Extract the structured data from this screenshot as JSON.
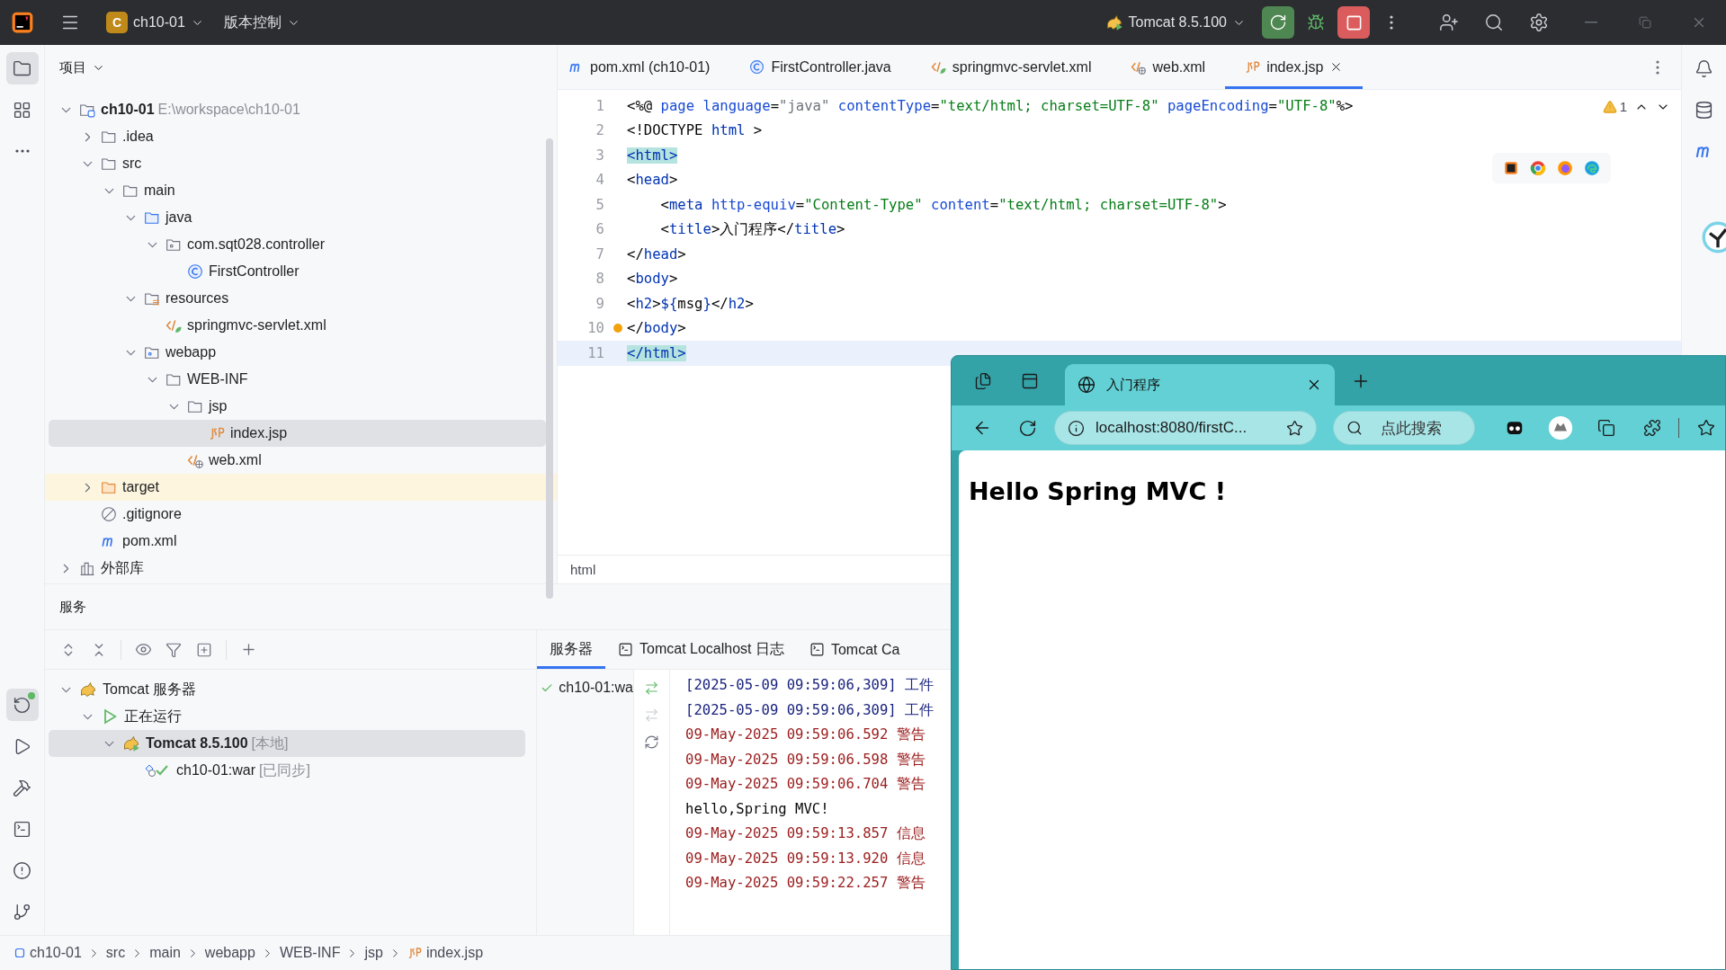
{
  "title_bar": {
    "project_badge": "C",
    "project": "ch10-01",
    "vcs": "版本控制",
    "run_config": "Tomcat 8.5.100"
  },
  "left_tools": [
    {
      "kind": "project",
      "selected": true
    },
    {
      "kind": "structure",
      "selected": false
    },
    {
      "kind": "more",
      "selected": false
    }
  ],
  "left_tools_bottom": [
    {
      "kind": "services",
      "selected": true
    },
    {
      "kind": "run",
      "selected": false
    },
    {
      "kind": "build",
      "selected": false
    },
    {
      "kind": "terminal",
      "selected": false
    },
    {
      "kind": "problems",
      "selected": false
    },
    {
      "kind": "git",
      "selected": false
    }
  ],
  "project_panel": {
    "title": "项目",
    "tree": [
      {
        "label": "ch10-01",
        "path": "E:\\workspace\\ch10-01",
        "kind": "module",
        "expanded": true,
        "selected": false,
        "children": [
          {
            "label": ".idea",
            "kind": "folder",
            "expanded": false,
            "selected": false
          },
          {
            "label": "src",
            "kind": "folder",
            "expanded": true,
            "selected": false,
            "children": [
              {
                "label": "main",
                "kind": "folder",
                "expanded": true,
                "selected": false,
                "children": [
                  {
                    "label": "java",
                    "kind": "source",
                    "expanded": true,
                    "selected": false,
                    "children": [
                      {
                        "label": "com.sqt028.controller",
                        "kind": "package",
                        "expanded": true,
                        "selected": false,
                        "children": [
                          {
                            "label": "FirstController",
                            "kind": "class",
                            "selected": false
                          }
                        ]
                      }
                    ]
                  },
                  {
                    "label": "resources",
                    "kind": "resources",
                    "expanded": true,
                    "selected": false,
                    "children": [
                      {
                        "label": "springmvc-servlet.xml",
                        "kind": "spring-xml",
                        "selected": false
                      }
                    ]
                  },
                  {
                    "label": "webapp",
                    "kind": "webapp",
                    "expanded": true,
                    "selected": false,
                    "children": [
                      {
                        "label": "WEB-INF",
                        "kind": "folder",
                        "expanded": true,
                        "selected": false,
                        "children": [
                          {
                            "label": "jsp",
                            "kind": "folder",
                            "expanded": true,
                            "selected": false,
                            "children": [
                              {
                                "label": "index.jsp",
                                "kind": "jsp",
                                "selected": true
                              }
                            ]
                          },
                          {
                            "label": "web.xml",
                            "kind": "web-xml",
                            "selected": false
                          }
                        ]
                      }
                    ]
                  }
                ]
              }
            ]
          },
          {
            "label": "target",
            "kind": "excluded",
            "expanded": false,
            "selected": false
          },
          {
            "label": ".gitignore",
            "kind": "ignored",
            "selected": false
          },
          {
            "label": "pom.xml",
            "kind": "maven",
            "selected": false
          }
        ]
      },
      {
        "label": "外部库",
        "kind": "library",
        "expanded": false,
        "selected": false
      }
    ]
  },
  "editor": {
    "tabs": [
      {
        "label": "pom.xml (ch10-01)",
        "kind": "maven",
        "selected": false
      },
      {
        "label": "FirstController.java",
        "kind": "class",
        "selected": false
      },
      {
        "label": "springmvc-servlet.xml",
        "kind": "spring-xml",
        "selected": false
      },
      {
        "label": "web.xml",
        "kind": "web-xml",
        "selected": false
      },
      {
        "label": "index.jsp",
        "kind": "jsp",
        "selected": true
      }
    ],
    "warnings": "1",
    "lines": [
      {
        "number": "1",
        "current": false,
        "intention": false,
        "tokens": [
          {
            "text": "<%@ ",
            "kind": "plain"
          },
          {
            "text": "page language",
            "kind": "attr"
          },
          {
            "text": "=",
            "kind": "plain"
          },
          {
            "text": "\"java\"",
            "kind": "muted"
          },
          {
            "text": " contentType",
            "kind": "attr"
          },
          {
            "text": "=",
            "kind": "plain"
          },
          {
            "text": "\"text/html; charset=UTF-8\"",
            "kind": "str"
          },
          {
            "text": " pageEncoding",
            "kind": "attr"
          },
          {
            "text": "=",
            "kind": "plain"
          },
          {
            "text": "\"UTF-8\"",
            "kind": "str"
          },
          {
            "text": "%>",
            "kind": "plain"
          }
        ]
      },
      {
        "number": "2",
        "current": false,
        "intention": false,
        "tokens": [
          {
            "text": "<!DOCTYPE ",
            "kind": "plain"
          },
          {
            "text": "html",
            "kind": "tag"
          },
          {
            "text": " >",
            "kind": "plain"
          }
        ]
      },
      {
        "number": "3",
        "current": false,
        "intention": false,
        "tokens": [
          {
            "text": "<html>",
            "kind": "match"
          }
        ]
      },
      {
        "number": "4",
        "current": false,
        "intention": false,
        "tokens": [
          {
            "text": "<",
            "kind": "plain"
          },
          {
            "text": "head",
            "kind": "tag"
          },
          {
            "text": ">",
            "kind": "plain"
          }
        ]
      },
      {
        "number": "5",
        "current": false,
        "intention": false,
        "tokens": [
          {
            "text": "    <",
            "kind": "plain"
          },
          {
            "text": "meta",
            "kind": "tag"
          },
          {
            "text": " http-equiv",
            "kind": "attr"
          },
          {
            "text": "=",
            "kind": "plain"
          },
          {
            "text": "\"Content-Type\"",
            "kind": "str"
          },
          {
            "text": " content",
            "kind": "attr"
          },
          {
            "text": "=",
            "kind": "plain"
          },
          {
            "text": "\"text/html; charset=UTF-8\"",
            "kind": "str"
          },
          {
            "text": ">",
            "kind": "plain"
          }
        ]
      },
      {
        "number": "6",
        "current": false,
        "intention": false,
        "tokens": [
          {
            "text": "    <",
            "kind": "plain"
          },
          {
            "text": "title",
            "kind": "tag"
          },
          {
            "text": ">入门程序</",
            "kind": "plain"
          },
          {
            "text": "title",
            "kind": "tag"
          },
          {
            "text": ">",
            "kind": "plain"
          }
        ]
      },
      {
        "number": "7",
        "current": false,
        "intention": false,
        "tokens": [
          {
            "text": "</",
            "kind": "plain"
          },
          {
            "text": "head",
            "kind": "tag"
          },
          {
            "text": ">",
            "kind": "plain"
          }
        ]
      },
      {
        "number": "8",
        "current": false,
        "intention": false,
        "tokens": [
          {
            "text": "<",
            "kind": "plain"
          },
          {
            "text": "body",
            "kind": "tag"
          },
          {
            "text": ">",
            "kind": "plain"
          }
        ]
      },
      {
        "number": "9",
        "current": false,
        "intention": false,
        "tokens": [
          {
            "text": "<",
            "kind": "plain"
          },
          {
            "text": "h2",
            "kind": "tag"
          },
          {
            "text": ">",
            "kind": "plain"
          },
          {
            "text": "${",
            "kind": "tag"
          },
          {
            "text": "msg",
            "kind": "plain"
          },
          {
            "text": "}",
            "kind": "tag"
          },
          {
            "text": "</",
            "kind": "plain"
          },
          {
            "text": "h2",
            "kind": "tag"
          },
          {
            "text": ">",
            "kind": "plain"
          }
        ]
      },
      {
        "number": "10",
        "current": false,
        "intention": true,
        "tokens": [
          {
            "text": "</",
            "kind": "plain"
          },
          {
            "text": "body",
            "kind": "tag"
          },
          {
            "text": ">",
            "kind": "plain"
          }
        ]
      },
      {
        "number": "11",
        "current": true,
        "intention": false,
        "tokens": [
          {
            "text": "</html>",
            "kind": "match"
          }
        ]
      }
    ],
    "breadcrumb": "html"
  },
  "services": {
    "title": "服务",
    "tree": [
      {
        "label": "Tomcat 服务器",
        "kind": "server-group",
        "expanded": true,
        "selected": false,
        "children": [
          {
            "label": "正在运行",
            "kind": "running",
            "expanded": true,
            "selected": false,
            "children": [
              {
                "label": "Tomcat 8.5.100",
                "note": "[本地]",
                "kind": "server",
                "expanded": true,
                "selected": true,
                "children": [
                  {
                    "label": "ch10-01:war",
                    "note": "[已同步]",
                    "kind": "artifact",
                    "selected": false
                  }
                ]
              }
            ]
          }
        ]
      }
    ],
    "tabs": [
      {
        "label": "服务器",
        "kind": "plain",
        "selected": true
      },
      {
        "label": "Tomcat Localhost 日志",
        "kind": "console",
        "selected": false
      },
      {
        "label": "Tomcat Ca",
        "kind": "console",
        "selected": false
      }
    ],
    "deployments": [
      {
        "label": "ch10-01:wa"
      }
    ],
    "actions": [
      {
        "kind": "deploy",
        "disabled": false
      },
      {
        "kind": "undeploy",
        "disabled": true
      },
      {
        "kind": "refresh",
        "disabled": false
      }
    ],
    "log": [
      {
        "text": "[2025-05-09 09:59:06,309] 工件",
        "kind": "ide"
      },
      {
        "text": "[2025-05-09 09:59:06,309] 工件",
        "kind": "ide"
      },
      {
        "text": "09-May-2025 09:59:06.592 警告",
        "kind": "server"
      },
      {
        "text": "09-May-2025 09:59:06.598 警告",
        "kind": "server"
      },
      {
        "text": "09-May-2025 09:59:06.704 警告",
        "kind": "server"
      },
      {
        "text": "hello,Spring MVC!",
        "kind": "stdout"
      },
      {
        "text": "09-May-2025 09:59:13.857 信息",
        "kind": "server"
      },
      {
        "text": "09-May-2025 09:59:13.920 信息",
        "kind": "server"
      },
      {
        "text": "09-May-2025 09:59:22.257 警告",
        "kind": "server"
      }
    ]
  },
  "status_bar": {
    "breadcrumb": [
      {
        "label": "ch10-01",
        "kind": "module"
      },
      {
        "label": "src",
        "kind": "plain"
      },
      {
        "label": "main",
        "kind": "plain"
      },
      {
        "label": "webapp",
        "kind": "plain"
      },
      {
        "label": "WEB-INF",
        "kind": "plain"
      },
      {
        "label": "jsp",
        "kind": "plain"
      },
      {
        "label": "index.jsp",
        "kind": "jsp"
      }
    ]
  },
  "browser": {
    "tabs": [
      {
        "title": "入门程序",
        "selected": true
      }
    ],
    "url": "localhost:8080/firstC...",
    "search_placeholder": "点此搜索",
    "heading": "Hello Spring MVC !"
  }
}
